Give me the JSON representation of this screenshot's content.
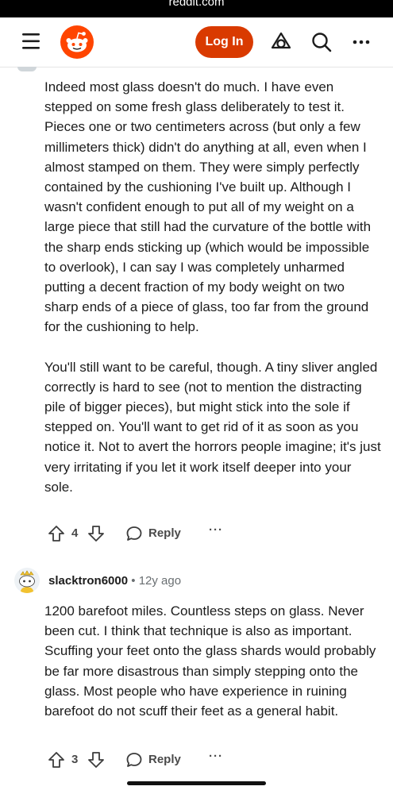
{
  "status_bar": {
    "url": "reddit.com"
  },
  "header": {
    "login_label": "Log In",
    "icons": [
      "menu-icon",
      "reddit-logo",
      "advertise-icon",
      "search-icon",
      "more-icon"
    ]
  },
  "comments": [
    {
      "paragraphs": [
        "Indeed most glass doesn't do much. I have even stepped on some fresh glass deliberately to test it. Pieces one or two centimeters across (but only a few millimeters thick) didn't do anything at all, even when I almost stamped on them. They were simply perfectly contained by the cushioning I've built up. Although I wasn't confident enough to put all of my weight on a large piece that still had the curvature of the bottle with the sharp ends sticking up (which would be impossible to overlook), I can say I was completely unharmed putting a decent fraction of my body weight on two sharp ends of a piece of glass, too far from the ground for the cushioning to help.",
        "You'll still want to be careful, though. A tiny sliver angled correctly is hard to see (not to mention the distracting pile of bigger pieces), but might stick into the sole if stepped on. You'll want to get rid of it as soon as you notice it. Not to avert the horrors people imagine; it's just very irritating if you let it work itself deeper into your sole."
      ],
      "score": "4",
      "reply_label": "Reply",
      "more_label": "···"
    },
    {
      "author": "slacktron6000",
      "separator": "•",
      "age": "12y ago",
      "paragraphs": [
        "1200 barefoot miles. Countless steps on glass. Never been cut. I think that technique is also as important. Scuffing your feet onto the glass shards would probably be far more disastrous than simply stepping onto the glass. Most people who have experience in ruining barefoot do not scuff their feet as a general habit."
      ],
      "score": "3",
      "reply_label": "Reply",
      "more_label": "···"
    }
  ],
  "colors": {
    "accent": "#d93a00",
    "text": "#1c1c1c",
    "muted": "#6a6f72"
  }
}
